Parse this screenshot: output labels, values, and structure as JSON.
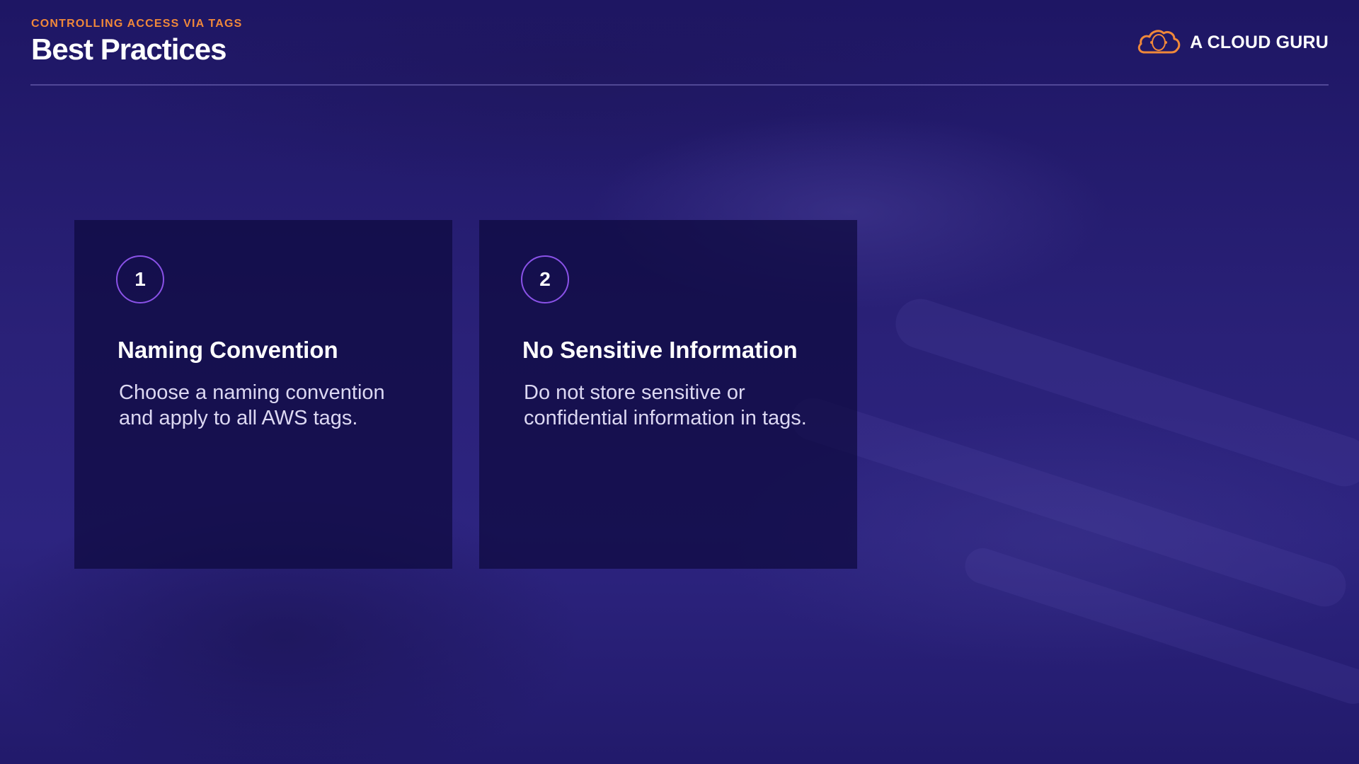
{
  "header": {
    "eyebrow": "CONTROLLING ACCESS VIA TAGS",
    "title": "Best Practices"
  },
  "brand": {
    "name": "A CLOUD GURU",
    "icon": "cloud-logo-icon",
    "accent_color": "#f0883a"
  },
  "cards": [
    {
      "number": "1",
      "title": "Naming Convention",
      "body": "Choose a naming convention and apply to all AWS tags."
    },
    {
      "number": "2",
      "title": "No Sensitive Information",
      "body": "Do not store sensitive or confidential information in tags."
    }
  ],
  "colors": {
    "background": "#241a6e",
    "card": "#0e0a3e",
    "circle_border": "#8a52e8",
    "eyebrow": "#f0883a"
  }
}
